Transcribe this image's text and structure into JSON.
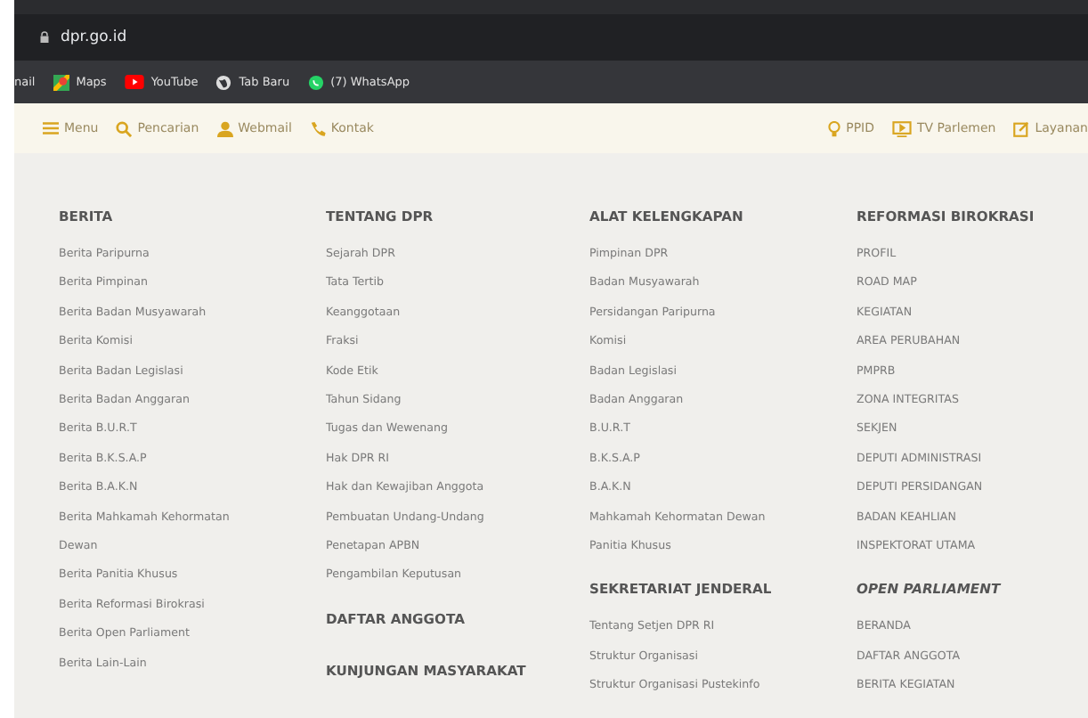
{
  "browser": {
    "url": "dpr.go.id",
    "bookmarks": [
      "nail",
      "Maps",
      "YouTube",
      "Tab Baru",
      "(7) WhatsApp"
    ]
  },
  "nav": {
    "left": [
      "Menu",
      "Pencarian",
      "Webmail",
      "Kontak"
    ],
    "right": [
      "PPID",
      "TV Parlemen",
      "Layanan"
    ]
  },
  "columns": [
    {
      "sections": [
        {
          "heading": "BERITA",
          "italic": false,
          "items": [
            "Berita Paripurna",
            "Berita Pimpinan",
            "Berita Badan Musyawarah",
            "Berita Komisi",
            "Berita Badan Legislasi",
            "Berita Badan Anggaran",
            "Berita B.U.R.T",
            "Berita B.K.S.A.P",
            "Berita B.A.K.N",
            "Berita Mahkamah Kehormatan",
            "Dewan",
            "Berita Panitia Khusus",
            "Berita Reformasi Birokrasi",
            "Berita Open Parliament",
            "Berita Lain-Lain"
          ]
        }
      ]
    },
    {
      "sections": [
        {
          "heading": "TENTANG DPR",
          "italic": false,
          "items": [
            "Sejarah DPR",
            "Tata Tertib",
            "Keanggotaan",
            "Fraksi",
            "Kode Etik",
            "Tahun Sidang",
            "Tugas dan Wewenang",
            "Hak DPR RI",
            "Hak dan Kewajiban Anggota",
            "Pembuatan Undang-Undang",
            "Penetapan APBN",
            "Pengambilan Keputusan"
          ]
        },
        {
          "heading": "DAFTAR ANGGOTA",
          "italic": false
        },
        {
          "heading": "KUNJUNGAN MASYARAKAT",
          "italic": false
        }
      ]
    },
    {
      "sections": [
        {
          "heading": "ALAT KELENGKAPAN",
          "italic": false,
          "items": [
            "Pimpinan DPR",
            "Badan Musyawarah",
            "Persidangan Paripurna",
            "Komisi",
            "Badan Legislasi",
            "Badan Anggaran",
            "B.U.R.T",
            "B.K.S.A.P",
            "B.A.K.N",
            "Mahkamah Kehormatan Dewan",
            "Panitia Khusus"
          ]
        },
        {
          "heading": "SEKRETARIAT JENDERAL",
          "italic": false,
          "items": [
            "Tentang Setjen DPR RI",
            "Struktur Organisasi",
            "Struktur Organisasi Pustekinfo"
          ]
        }
      ]
    },
    {
      "sections": [
        {
          "heading": "REFORMASI BIROKRASI",
          "italic": false,
          "items": [
            "PROFIL",
            "ROAD MAP",
            "KEGIATAN",
            "AREA PERUBAHAN",
            "PMPRB",
            "ZONA INTEGRITAS",
            "SEKJEN",
            "DEPUTI ADMINISTRASI",
            "DEPUTI PERSIDANGAN",
            "BADAN KEAHLIAN",
            "INSPEKTORAT UTAMA"
          ]
        },
        {
          "heading": "OPEN PARLIAMENT",
          "italic": true,
          "items": [
            "BERANDA",
            "DAFTAR ANGGOTA",
            "BERITA KEGIATAN"
          ]
        }
      ]
    }
  ]
}
